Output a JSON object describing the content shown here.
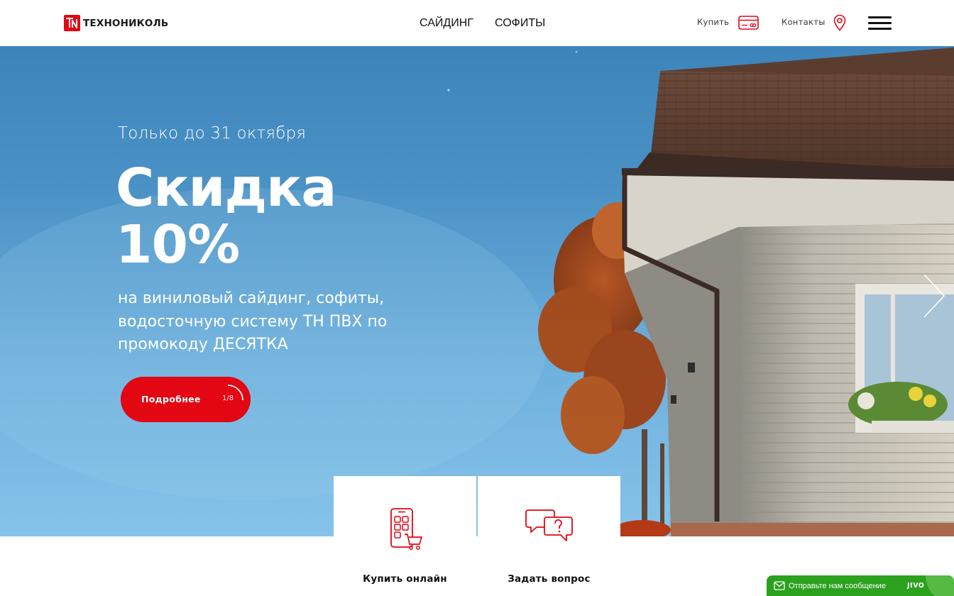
{
  "brand": {
    "logo_text": "ТЕХНОНИКОЛЬ",
    "logo_mark": "ТН",
    "accent": "#e30613"
  },
  "header": {
    "nav": [
      {
        "label": "САЙДИНГ"
      },
      {
        "label": "СОФИТЫ"
      }
    ],
    "buy_label": "Купить",
    "contacts_label": "Контакты",
    "icons": {
      "buy": "credit-card-icon",
      "contacts": "map-pin-icon",
      "menu": "hamburger-menu-icon"
    }
  },
  "hero": {
    "kicker": "Только до 31 октября",
    "title_line1": "Скидка",
    "title_line2": "10%",
    "description": "на виниловый сайдинг, софиты, водосточную систему ТН ПВХ по промокоду ДЕСЯТКА",
    "button_label": "Подробнее",
    "slide_counter": "1/8",
    "slide_current": 1,
    "slide_total": 8
  },
  "quick_actions": [
    {
      "label": "Купить онлайн",
      "icon": "phone-cart-icon"
    },
    {
      "label": "Задать вопрос",
      "icon": "chat-question-icon"
    }
  ],
  "chat_widget": {
    "text": "Отправьте нам сообщение",
    "brand": "JIVO",
    "color": "#2ca11e"
  }
}
